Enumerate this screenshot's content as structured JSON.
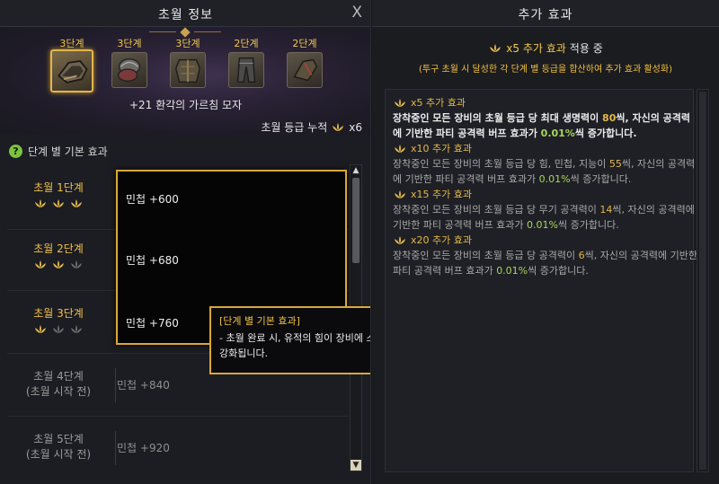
{
  "left_panel": {
    "title": "초월 정보",
    "close_label": "X",
    "gear": [
      {
        "stage": "3단계",
        "icon": "gloves-icon",
        "selected": true
      },
      {
        "stage": "3단계",
        "icon": "shoulder-armor-icon",
        "selected": false
      },
      {
        "stage": "3단계",
        "icon": "chest-armor-icon",
        "selected": false
      },
      {
        "stage": "2단계",
        "icon": "pants-icon",
        "selected": false
      },
      {
        "stage": "2단계",
        "icon": "gauntlet-icon",
        "selected": false
      }
    ],
    "item_name": "+21 환각의 가르침 모자",
    "accumulated_label": "초월 등급 누적",
    "accumulated_value": "x6",
    "section_title": "단계 별 기본 효과",
    "stages": [
      {
        "name": "초월 1단계",
        "sub": "",
        "value": "민첩 +600",
        "active_icons": 3
      },
      {
        "name": "초월 2단계",
        "sub": "",
        "value": "민첩 +680",
        "active_icons": 2
      },
      {
        "name": "초월 3단계",
        "sub": "",
        "value": "민첩 +760",
        "active_icons": 1
      },
      {
        "name": "초월 4단계",
        "sub": "(초월 시작 전)",
        "value": "민첩 +840",
        "active_icons": 0
      },
      {
        "name": "초월 5단계",
        "sub": "(초월 시작 전)",
        "value": "민첩 +920",
        "active_icons": 0
      }
    ],
    "tooltip": {
      "title": "[단계 별 기본 효과]",
      "body": "- 초월 완료 시, 유적의 힘이 장비에 스며들어 기본 효과가 강화됩니다."
    }
  },
  "right_panel": {
    "title": "추가 효과",
    "active_prefix": "x5 추가 효과",
    "active_suffix": "적용 중",
    "note": "(투구 초월 시 달성한 각 단계 별 등급을 합산하여 추가 효과 활성화)",
    "effects": [
      {
        "head": "x5 추가 효과",
        "pre": "장착중인 모든 장비의 초월 등급 당 최대 생명력이 ",
        "num": "80",
        "mid": "씩, 자신의 공격력에 기반한 파티 공격력 버프 효과가 ",
        "pct": "0.01%",
        "post": "씩 증가합니다.",
        "active": true
      },
      {
        "head": "x10 추가 효과",
        "pre": "장착중인 모든 장비의 초월 등급 당 힘, 민첩, 지능이 ",
        "num": "55",
        "mid": "씩, 자신의 공격력에 기반한 파티 공격력 버프 효과가 ",
        "pct": "0.01%",
        "post": "씩 증가합니다.",
        "active": false
      },
      {
        "head": "x15 추가 효과",
        "pre": "장착중인 모든 장비의 초월 등급 당 무기 공격력이 ",
        "num": "14",
        "mid": "씩, 자신의 공격력에 기반한 파티 공격력 버프 효과가 ",
        "pct": "0.01%",
        "post": "씩 증가합니다.",
        "active": false
      },
      {
        "head": "x20 추가 효과",
        "pre": "장착중인 모든 장비의 초월 등급 당 공격력이 ",
        "num": "6",
        "mid": "씩, 자신의 공격력에 기반한 파티 공격력 버프 효과가 ",
        "pct": "0.01%",
        "post": "씩 증가합니다.",
        "active": false
      }
    ]
  },
  "colors": {
    "gold": "#f2c94c",
    "popup_border": "#d9a83a",
    "inactive_icon": "#6d6d6d",
    "percent_green": "#a6d65c"
  }
}
